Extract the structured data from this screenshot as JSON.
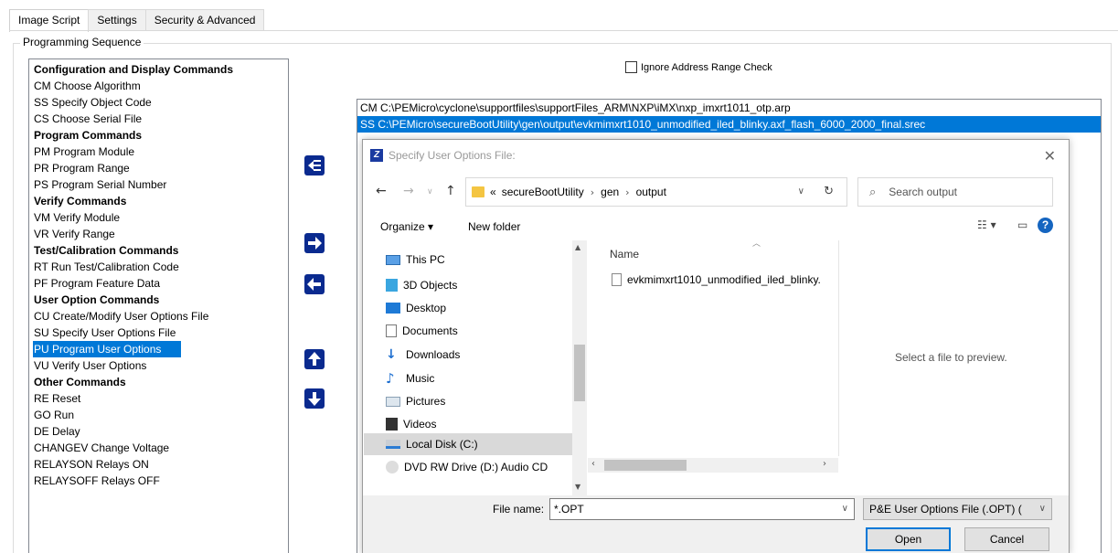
{
  "tabs": [
    "Image Script",
    "Settings",
    "Security & Advanced"
  ],
  "group_label": "Programming Sequence",
  "commands": [
    {
      "text": "Configuration and Display Commands",
      "header": true
    },
    {
      "text": "CM  Choose Algorithm"
    },
    {
      "text": "SS  Specify Object Code"
    },
    {
      "text": "CS  Choose Serial File"
    },
    {
      "text": "Program Commands",
      "header": true
    },
    {
      "text": "PM  Program Module"
    },
    {
      "text": "PR  Program Range"
    },
    {
      "text": "PS  Program Serial Number"
    },
    {
      "text": "Verify Commands",
      "header": true
    },
    {
      "text": "VM  Verify Module"
    },
    {
      "text": "VR  Verify Range"
    },
    {
      "text": "Test/Calibration Commands",
      "header": true
    },
    {
      "text": "RT  Run Test/Calibration Code"
    },
    {
      "text": "PF  Program Feature Data"
    },
    {
      "text": "User Option Commands",
      "header": true
    },
    {
      "text": "CU  Create/Modify User Options File"
    },
    {
      "text": "SU  Specify User Options File"
    },
    {
      "text": "PU  Program User Options",
      "selected": true
    },
    {
      "text": "VU  Verify User Options"
    },
    {
      "text": "Other Commands",
      "header": true
    },
    {
      "text": "RE  Reset"
    },
    {
      "text": "GO  Run"
    },
    {
      "text": "DE  Delay"
    },
    {
      "text": "CHANGEV  Change Voltage"
    },
    {
      "text": "RELAYSON  Relays ON"
    },
    {
      "text": "RELAYSOFF  Relays OFF"
    }
  ],
  "ignore_checkbox": {
    "label": "Ignore Address Range Check",
    "checked": false
  },
  "sequence": [
    {
      "text": "CM  C:\\PEMicro\\cyclone\\supportfiles\\supportFiles_ARM\\NXP\\iMX\\nxp_imxrt1011_otp.arp",
      "selected": false
    },
    {
      "text": "SS  C:\\PEMicro\\secureBootUtility\\gen\\output\\evkmimxrt1010_unmodified_iled_blinky.axf_flash_6000_2000_final.srec",
      "selected": true
    }
  ],
  "dialog": {
    "title": "Specify User Options File:",
    "logo_letter": "Z",
    "breadcrumb": [
      "secureBootUtility",
      "gen",
      "output"
    ],
    "breadcrumb_prefix": "«",
    "search_placeholder": "Search output",
    "organize_label": "Organize ▾",
    "new_folder_label": "New folder",
    "tree": [
      {
        "label": "This PC",
        "icon": "pc-icon"
      },
      {
        "label": "3D Objects",
        "icon": "3d-objects-icon"
      },
      {
        "label": "Desktop",
        "icon": "desktop-icon"
      },
      {
        "label": "Documents",
        "icon": "documents-icon"
      },
      {
        "label": "Downloads",
        "icon": "downloads-icon"
      },
      {
        "label": "Music",
        "icon": "music-icon"
      },
      {
        "label": "Pictures",
        "icon": "pictures-icon"
      },
      {
        "label": "Videos",
        "icon": "videos-icon"
      },
      {
        "label": "Local Disk (C:)",
        "icon": "drive-icon",
        "selected": true
      },
      {
        "label": "DVD RW Drive (D:) Audio CD",
        "icon": "dvd-icon"
      }
    ],
    "name_column": "Name",
    "file": "evkmimxrt1010_unmodified_iled_blinky.",
    "preview_text": "Select a file to preview.",
    "file_name_label": "File name:",
    "file_name_value": "*.OPT",
    "file_type": "P&E User Options File (.OPT) (",
    "open_label": "Open",
    "cancel_label": "Cancel"
  },
  "colors": {
    "selection": "#0078d7",
    "arrow_button": "#0a2a8f"
  }
}
